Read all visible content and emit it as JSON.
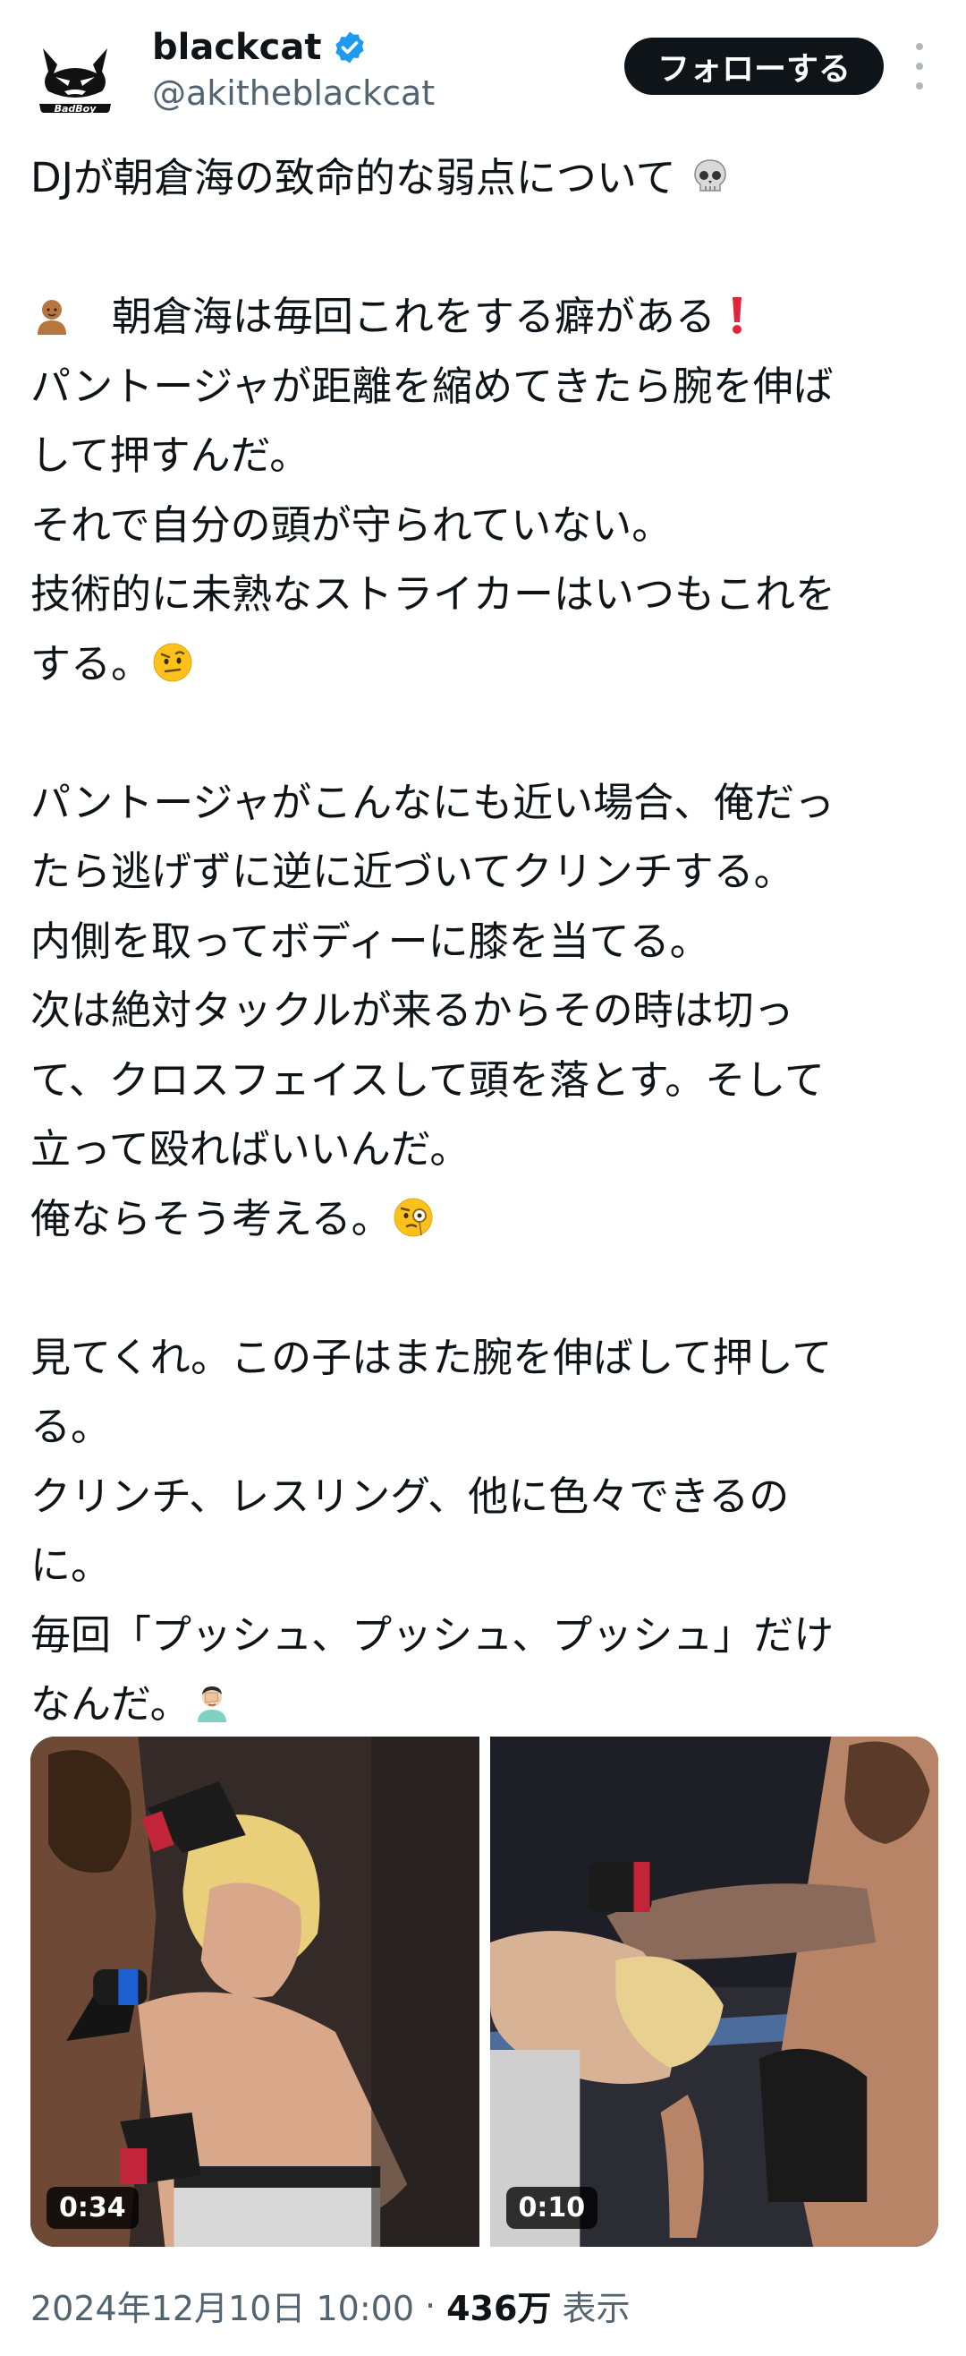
{
  "author": {
    "name": "blackcat",
    "handle": "@akitheblackcat",
    "verified_color": "#1d9bf0",
    "avatar_logo_text": "BadBoy"
  },
  "follow_button": {
    "label": "フォローする"
  },
  "more_menu": {
    "icon": "more-vertical-icon"
  },
  "tweet": {
    "lines": {
      "l1": "DJが朝倉海の致命的な弱点について",
      "l3": "朝倉海は毎回これをする癖がある",
      "l4": "パントージャが距離を縮めてきたら腕を伸ば",
      "l5": "して押すんだ。",
      "l6": "それで自分の頭が守られていない。",
      "l7": "技術的に未熟なストライカーはいつもこれを",
      "l8": "する。",
      "l10": "パントージャがこんなにも近い場合、俺だっ",
      "l11": "たら逃げずに逆に近づいてクリンチする。",
      "l12": "内側を取ってボディーに膝を当てる。",
      "l13": "次は絶対タックルが来るからその時は切っ",
      "l14": "て、クロスフェイスして頭を落とす。そして",
      "l15": "立って殴ればいいんだ。",
      "l16": "俺ならそう考える。",
      "l18": "見てくれ。この子はまた腕を伸ばして押して",
      "l19": "る。",
      "l20": "クリンチ、レスリング、他に色々できるの",
      "l21": "に。",
      "l22": "毎回「プッシュ、プッシュ、プッシュ」だけ",
      "l23": "なんだ。"
    },
    "emojis": [
      "skull-emoji",
      "bald-man-emoji",
      "exclamation-emoji",
      "raised-eyebrow-emoji",
      "monocle-emoji",
      "facepalm-emoji"
    ]
  },
  "media": [
    {
      "duration": "0:34",
      "icon": "video-thumbnail"
    },
    {
      "duration": "0:10",
      "icon": "video-thumbnail"
    }
  ],
  "meta": {
    "timestamp": "2024年12月10日 10:00",
    "separator": "·",
    "views_count": "436万",
    "views_label": "表示"
  }
}
